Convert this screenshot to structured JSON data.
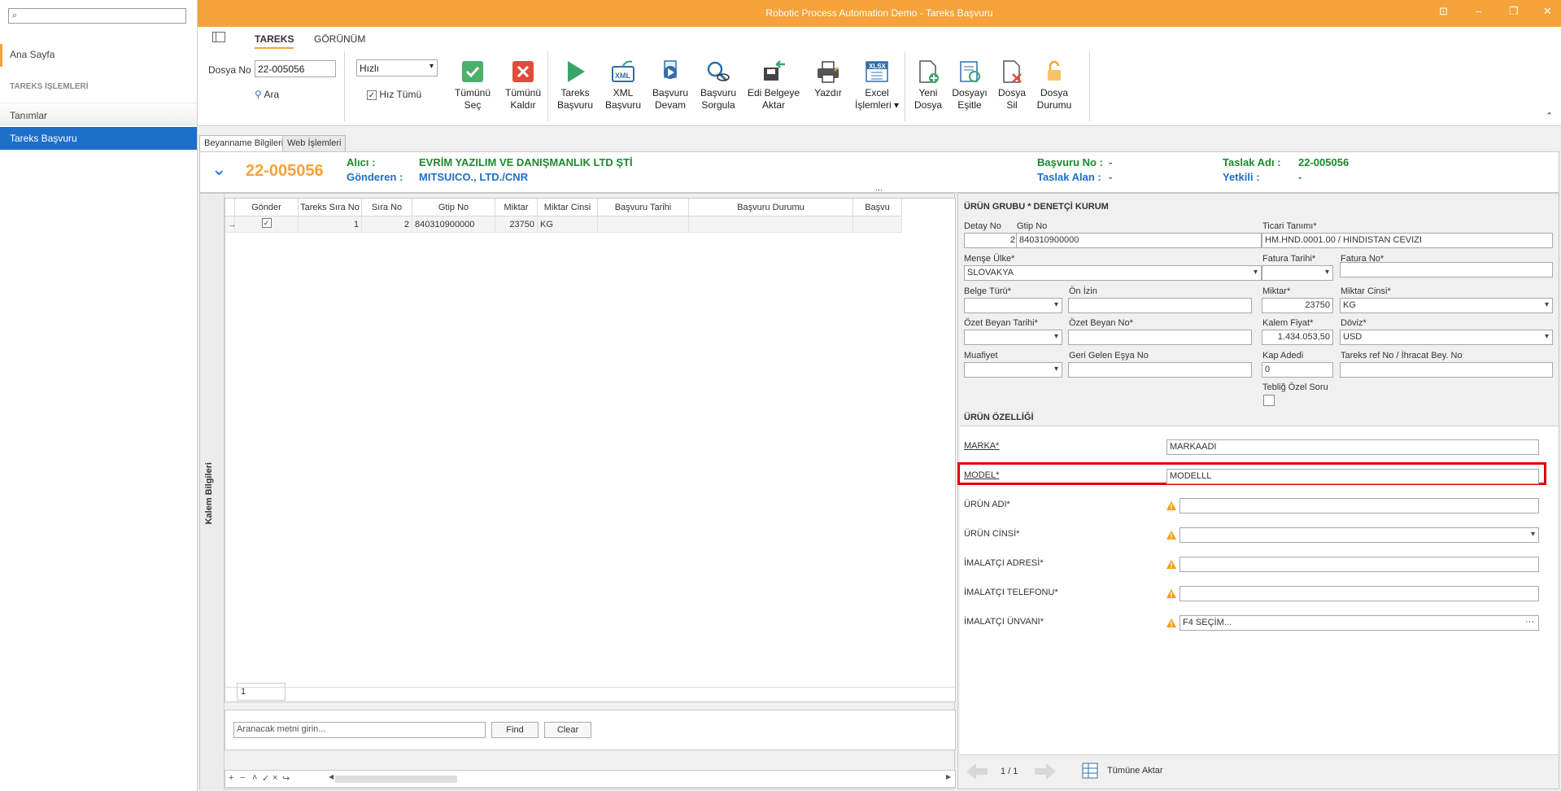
{
  "app": {
    "title": "Robotic Process Automation Demo - Tareks Başvuru"
  },
  "sidebar": {
    "search_placeholder": "",
    "home": "Ana Sayfa",
    "section": "TAREKS İŞLEMLERİ",
    "items": [
      {
        "label": "Tanımlar"
      },
      {
        "label": "Tareks Başvuru"
      }
    ]
  },
  "ribbon": {
    "tabs": [
      "TAREKS",
      "GÖRÜNÜM"
    ],
    "dosya_label": "Dosya No",
    "dosya_value": "22-005056",
    "ara": "Ara",
    "speed": "Hızlı",
    "hiz_tumu": "Hız Tümü",
    "buttons": [
      {
        "l1": "Tümünü",
        "l2": "Seç",
        "icon": "check-icon"
      },
      {
        "l1": "Tümünü",
        "l2": "Kaldır",
        "icon": "x-icon"
      },
      {
        "l1": "Tareks",
        "l2": "Başvuru",
        "icon": "play-icon"
      },
      {
        "l1": "XML",
        "l2": "Başvuru",
        "icon": "xml-icon"
      },
      {
        "l1": "Başvuru",
        "l2": "Devam",
        "icon": "resume-icon"
      },
      {
        "l1": "Başvuru",
        "l2": "Sorgula",
        "icon": "search-doc-icon"
      },
      {
        "l1": "Edi Belgeye",
        "l2": "Aktar",
        "icon": "transfer-icon"
      },
      {
        "l1": "Yazdır",
        "l2": "",
        "icon": "printer-icon"
      },
      {
        "l1": "Excel",
        "l2": "İşlemleri ▾",
        "icon": "excel-icon"
      },
      {
        "l1": "Yeni",
        "l2": "Dosya",
        "icon": "new-file-icon"
      },
      {
        "l1": "Dosyayı",
        "l2": "Eşitle",
        "icon": "sync-file-icon"
      },
      {
        "l1": "Dosya",
        "l2": "Sil",
        "icon": "delete-file-icon"
      },
      {
        "l1": "Dosya",
        "l2": "Durumu",
        "icon": "lock-icon"
      }
    ]
  },
  "tabs": [
    "Beyanname Bilgileri",
    "Web İşlemleri"
  ],
  "header": {
    "number": "22-005056",
    "alici_label": "Alıcı :",
    "alici": "EVRİM YAZILIM VE DANIŞMANLIK LTD ŞTİ",
    "gonderen_label": "Gönderen :",
    "gonderen": "MITSUICO., LTD./CNR",
    "basvuru_no_label": "Başvuru No :",
    "basvuru_no": "-",
    "taslak_alan_label": "Taslak Alan :",
    "taslak_alan": "-",
    "taslak_adi_label": "Taslak Adı :",
    "taslak_adi": "22-005056",
    "yetkili_label": "Yetkili :",
    "yetkili": "-",
    "more": "..."
  },
  "grid": {
    "side_label": "Kalem Bilgileri",
    "columns": [
      "Gönder",
      "Tareks Sıra No",
      "Sıra No",
      "Gtip No",
      "Miktar",
      "Miktar Cinsi",
      "Başvuru Tarihi",
      "Başvuru Durumu",
      "Başvu"
    ],
    "row": {
      "checked": "✓",
      "tareks_sira": "1",
      "sira": "2",
      "gtip": "840310900000",
      "miktar": "23750",
      "cins": "KG",
      "tarih": "",
      "durum": ""
    },
    "footer_count": "1",
    "search_placeholder": "Aranacak metni girin...",
    "find": "Find",
    "clear": "Clear"
  },
  "form": {
    "group": "ÜRÜN GRUBU  *  DENETÇİ KURUM",
    "detay_no_l": "Detay No",
    "detay_no": "2",
    "gtip_l": "Gtip No",
    "gtip": "840310900000",
    "ticari_l": "Ticari Tanımı*",
    "ticari": "HM.HND.0001.00 / HINDISTAN CEVIZI",
    "mense_l": "Menşe Ülke*",
    "mense": "SLOVAKYA",
    "fatura_tarihi_l": "Fatura Tarihi*",
    "fatura_no_l": "Fatura No*",
    "belge_l": "Belge Türü*",
    "on_izin_l": "Ön İzin",
    "miktar_l": "Miktar*",
    "miktar": "23750",
    "miktar_cinsi_l": "Miktar Cinsi*",
    "miktar_cinsi": "KG",
    "ozet_tarih_l": "Özet Beyan Tarihi*",
    "ozet_no_l": "Özet Beyan No*",
    "kalem_l": "Kalem Fiyat*",
    "kalem": "1.434.053,50",
    "doviz_l": "Döviz*",
    "doviz": "USD",
    "muafiyet_l": "Muafiyet",
    "geri_l": "Geri Gelen Eşya No",
    "kap_l": "Kap Adedi",
    "kap": "0",
    "tareks_ref_l": "Tareks ref No / İhracat Bey. No",
    "teblig_l": "Tebliğ Özel Soru"
  },
  "props": {
    "title": "ÜRÜN ÖZELLİĞİ",
    "items": [
      {
        "label": "MARKA*",
        "value": "MARKAADI"
      },
      {
        "label": "MODEL*",
        "value": "MODELLL"
      },
      {
        "label": "ÜRÜN ADI*",
        "value": ""
      },
      {
        "label": "ÜRÜN CİNSİ*",
        "value": ""
      },
      {
        "label": "İMALATÇI ADRESİ*",
        "value": ""
      },
      {
        "label": "İMALATÇI TELEFONU*",
        "value": ""
      },
      {
        "label": "İMALATÇI ÜNVANI*",
        "value": "F4 SEÇİM..."
      }
    ]
  },
  "nav": {
    "page": "1 / 1",
    "transfer": "Tümüne Aktar"
  },
  "colors": {
    "accent": "#f5a33a",
    "select": "#1e6fc9",
    "green": "#1a8a2a",
    "blue": "#1e6fc9",
    "highlight": "#e00000"
  }
}
